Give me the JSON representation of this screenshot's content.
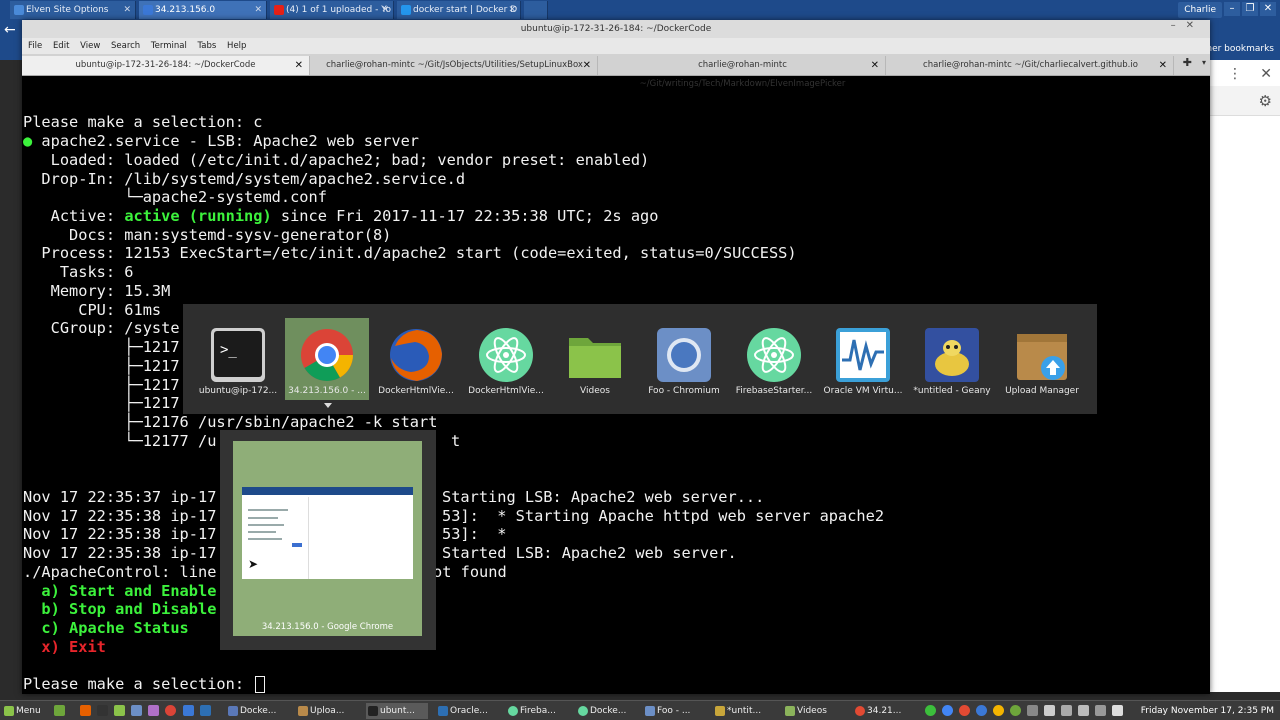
{
  "chrome": {
    "tabs": [
      {
        "title": "Elven Site Options",
        "favicon_color": "#4a8ad8"
      },
      {
        "title": "34.213.156.0",
        "favicon_color": "#3b78d6"
      },
      {
        "title": "(4) 1 of 1 uploaded - Yo",
        "favicon_color": "#e62117"
      },
      {
        "title": "docker start | Docker D",
        "favicon_color": "#2496ed"
      }
    ],
    "profile": "Charlie",
    "other_bookmarks": "Other bookmarks"
  },
  "terminal": {
    "title": "ubuntu@ip-172-31-26-184: ~/DockerCode",
    "menu": [
      "File",
      "Edit",
      "View",
      "Search",
      "Terminal",
      "Tabs",
      "Help"
    ],
    "tabs": [
      "ubuntu@ip-172-31-26-184: ~/DockerCode",
      "charlie@rohan-mintc ~/Git/JsObjects/Utilities/SetupLinuxBox",
      "charlie@rohan-mintc ~/Git/writings/Tech/Markdown/ElvenImagePicker",
      "charlie@rohan-mintc ~/Git/charliecalvert.github.io"
    ],
    "lines": {
      "l1": "Please make a selection: c",
      "l2_dot": "●",
      "l2": " apache2.service - LSB: Apache2 web server",
      "l3": "   Loaded: loaded (/etc/init.d/apache2; bad; vendor preset: enabled)",
      "l4": "  Drop-In: /lib/systemd/system/apache2.service.d",
      "l5": "           └─apache2-systemd.conf",
      "l6a": "   Active: ",
      "l6b": "active (running)",
      "l6c": " since Fri 2017-11-17 22:35:38 UTC; 2s ago",
      "l7": "     Docs: man:systemd-sysv-generator(8)",
      "l8": "  Process: 12153 ExecStart=/etc/init.d/apache2 start (code=exited, status=0/SUCCESS)",
      "l9": "    Tasks: 6",
      "l10": "   Memory: 15.3M",
      "l11": "      CPU: 61ms",
      "l12": "   CGroup: /syste",
      "l13": "           ├─1217",
      "l14": "           ├─1217",
      "l15": "           ├─1217",
      "l16": "           ├─1217",
      "l17": "           ├─12176 /usr/sbin/apache2 -k start",
      "l18": "           └─12177 /u",
      "l18b": "t",
      "l19a": "Nov 17 22:35:37 ip-17",
      "l19b": "Starting LSB: Apache2 web server...",
      "l20a": "Nov 17 22:35:38 ip-17",
      "l20b": "53]:  * Starting Apache httpd web server apache2",
      "l21a": "Nov 17 22:35:38 ip-17",
      "l21b": "53]:  *",
      "l22a": "Nov 17 22:35:38 ip-17",
      "l22b": "Started LSB: Apache2 web server.",
      "l23a": "./ApacheControl: line",
      "l23b": "ot found",
      "opt_a": "  a) Start and Enable",
      "opt_b": "  b) Stop and Disable",
      "opt_c": "  c) Apache Status",
      "opt_x": "  x) Exit",
      "prompt": "Please make a selection: "
    }
  },
  "switcher": {
    "items": [
      {
        "label": "ubuntu@ip-172...",
        "icon": "terminal-icon"
      },
      {
        "label": "34.213.156.0 - ...",
        "icon": "chrome-icon"
      },
      {
        "label": "DockerHtmlVie...",
        "icon": "firefox-icon"
      },
      {
        "label": "DockerHtmlVie...",
        "icon": "atom-icon"
      },
      {
        "label": "Videos",
        "icon": "folder-icon"
      },
      {
        "label": "Foo - Chromium",
        "icon": "chromium-icon"
      },
      {
        "label": "FirebaseStarter...",
        "icon": "atom-icon"
      },
      {
        "label": "Oracle VM Virtu...",
        "icon": "virtualbox-icon"
      },
      {
        "label": "*untitled - Geany",
        "icon": "geany-icon"
      },
      {
        "label": "Upload Manager",
        "icon": "upload-manager-icon"
      }
    ],
    "selected_index": 1,
    "preview_caption": "34.213.156.0 - Google Chrome"
  },
  "taskbar": {
    "menu_label": "Menu",
    "items": [
      {
        "label": "Docke...",
        "color": "#5a78b8"
      },
      {
        "label": "Uploa...",
        "color": "#b98a4a"
      },
      {
        "label": "ubunt...",
        "color": "#222222"
      },
      {
        "label": "Oracle...",
        "color": "#2d6fb3"
      },
      {
        "label": "Fireba...",
        "color": "#66d8a0"
      },
      {
        "label": "Docke...",
        "color": "#66d8a0"
      },
      {
        "label": "Foo - ...",
        "color": "#6c8fc6"
      },
      {
        "label": "*untit...",
        "color": "#c8a63a"
      },
      {
        "label": "Videos",
        "color": "#8bb35b"
      },
      {
        "label": "34.21...",
        "color": "#e24a33"
      }
    ],
    "clock": "Friday November 17,  2:35 PM"
  }
}
